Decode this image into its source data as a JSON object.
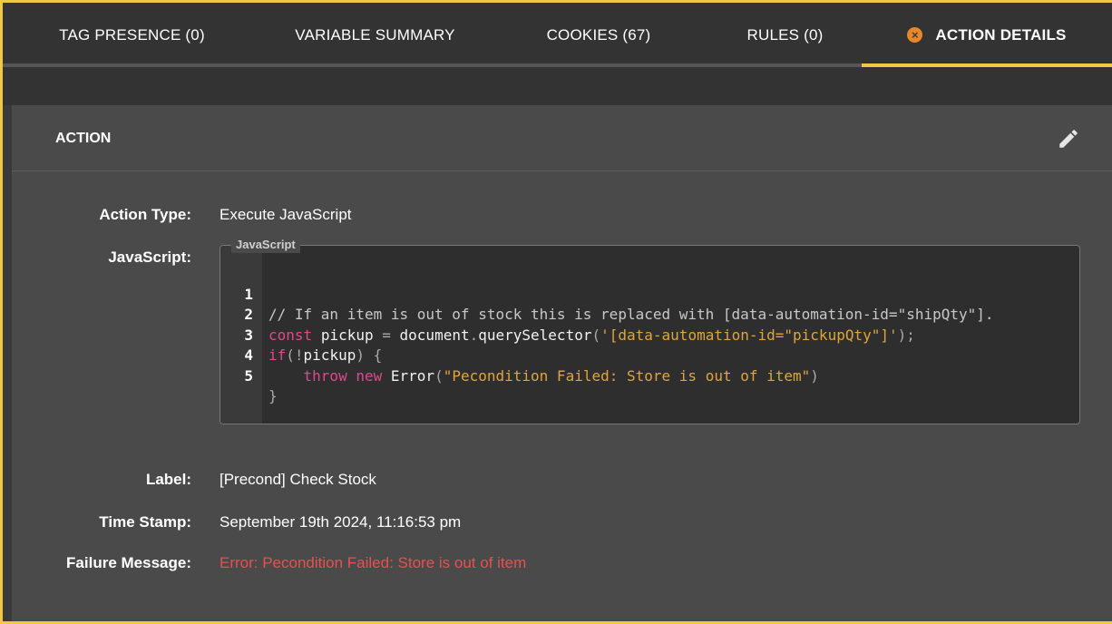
{
  "tabs": [
    {
      "label": "TAG PRESENCE (0)",
      "active": false
    },
    {
      "label": "VARIABLE SUMMARY",
      "active": false
    },
    {
      "label": "COOKIES (67)",
      "active": false
    },
    {
      "label": "RULES (0)",
      "active": false
    },
    {
      "label": "ACTION DETAILS",
      "active": true,
      "close_icon": "close-icon"
    }
  ],
  "panel": {
    "title": "ACTION",
    "edit_icon": "pencil-icon"
  },
  "fields": {
    "action_type_label": "Action Type:",
    "action_type_value": "Execute JavaScript",
    "javascript_label": "JavaScript:",
    "code_legend": "JavaScript",
    "label_label": "Label:",
    "label_value": "[Precond] Check Stock",
    "timestamp_label": "Time Stamp:",
    "timestamp_value": "September 19th 2024, 11:16:53 pm",
    "failure_label": "Failure Message:",
    "failure_value": "Error: Pecondition Failed: Store is out of item"
  },
  "code": {
    "line_numbers": [
      "1",
      "2",
      "3",
      "4",
      "5"
    ],
    "lines": [
      "// If an item is out of stock this is replaced with [data-automation-id=\"shipQty\"].",
      "const pickup = document.querySelector('[data-automation-id=\"pickupQty\"]');",
      "if(!pickup) {",
      "    throw new Error(\"Pecondition Failed: Store is out of item\")",
      "}"
    ]
  },
  "colors": {
    "accent": "#f2c744",
    "error": "#e8504f",
    "keyword": "#e0478f",
    "string": "#e0a53a",
    "close_badge": "#e8862a"
  }
}
